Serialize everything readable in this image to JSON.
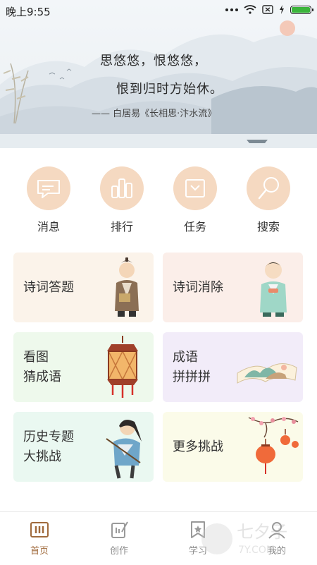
{
  "status": {
    "time": "晚上9:55"
  },
  "hero": {
    "line1": "思悠悠，恨悠悠，",
    "line2": "恨到归时方始休。",
    "author": "—— 白居易《长相思·汴水流》"
  },
  "quick_actions": [
    {
      "label": "消息",
      "icon": "message-icon"
    },
    {
      "label": "排行",
      "icon": "ranking-icon"
    },
    {
      "label": "任务",
      "icon": "task-icon"
    },
    {
      "label": "搜索",
      "icon": "search-icon"
    }
  ],
  "games": [
    {
      "line1": "诗词答题",
      "line2": ""
    },
    {
      "line1": "诗词消除",
      "line2": ""
    },
    {
      "line1": "看图",
      "line2": "猜成语"
    },
    {
      "line1": "成语",
      "line2": "拼拼拼"
    },
    {
      "line1": "历史专题",
      "line2": "大挑战"
    },
    {
      "line1": "更多挑战",
      "line2": ""
    }
  ],
  "nav": [
    {
      "label": "首页",
      "icon": "home-icon",
      "active": true
    },
    {
      "label": "创作",
      "icon": "compose-icon",
      "active": false
    },
    {
      "label": "学习",
      "icon": "study-icon",
      "active": false
    },
    {
      "label": "我的",
      "icon": "profile-icon",
      "active": false
    }
  ],
  "watermark": {
    "text": "七夕子",
    "sub": "7Y.COM"
  },
  "colors": {
    "accent": "#a06a3c",
    "icon_circle": "#f5d9c1",
    "battery": "#3bb53b"
  }
}
